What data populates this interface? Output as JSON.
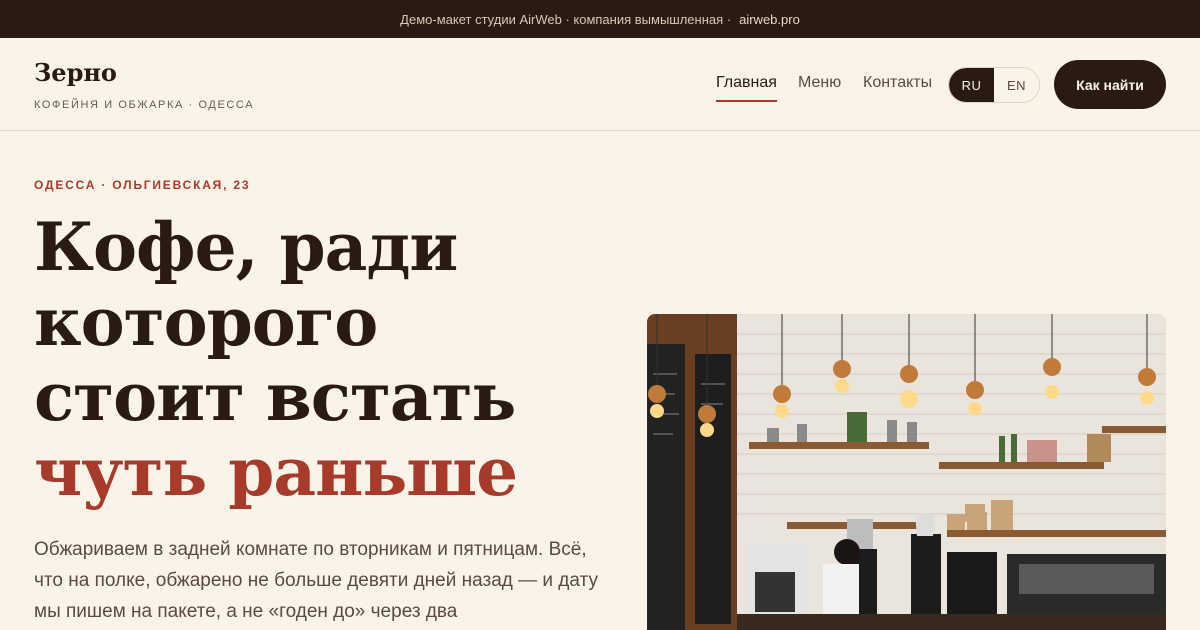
{
  "topbar": {
    "text": "Демо-макет студии AirWeb · компания вымышленная ·",
    "link": "airweb.pro"
  },
  "brand": {
    "name": "Зерно",
    "subtitle": "КОФЕЙНЯ И ОБЖАРКА · ОДЕССА"
  },
  "nav": {
    "items": [
      {
        "label": "Главная"
      },
      {
        "label": "Меню"
      },
      {
        "label": "Контакты"
      }
    ],
    "lang": [
      "RU",
      "EN"
    ],
    "cta": "Как найти"
  },
  "hero": {
    "eyebrow": "ОДЕССА · ОЛЬГИЕВСКАЯ, 23",
    "lines": [
      "Кофе, ради",
      "которого",
      "стоит встать",
      "чуть раньше"
    ],
    "lead": "Обжариваем в задней комнате по вторникам и пятницам. Всё, что на полке, обжарено не больше девяти дней назад — и дату мы пишем на пакете, а не «годен до» через два"
  },
  "colors": {
    "dark": "#2a1a14",
    "accent": "#a83a2c",
    "cream": "#faf4e8"
  }
}
